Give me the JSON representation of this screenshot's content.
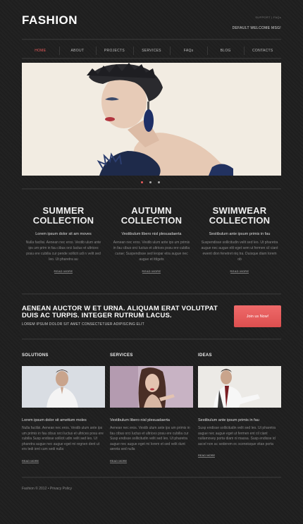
{
  "header": {
    "logo": "FASHION",
    "top_links": "SUPPORT | FAQs",
    "welcome": "DEFAULT WELCOME MSG!"
  },
  "nav": {
    "items": [
      "HOME",
      "ABOUT",
      "PROJECTS",
      "SERVICES",
      "FAQs",
      "BLOG",
      "CONTACTS"
    ],
    "active_index": 0
  },
  "slider": {
    "dot_count": 3,
    "active_dot": 0
  },
  "collections": [
    {
      "title_line1": "SUMMER",
      "title_line2": "COLLECTION",
      "subtitle": "Lorem ipsum dolor sit am moves",
      "text": "Nulla facilisi. Aenean nec eros. Vestib ulum ante ips um prim in fau cibus orci luctus et ultrices posu ere cubilia cur pende sollicit udi n velit sed leo. Ut pharetra au",
      "more": "READ MORE"
    },
    {
      "title_line1": "AUTUMN",
      "title_line2": "COLLECTION",
      "subtitle": "Vestibulum libero nisl plesuadaerta",
      "text": "Aenean nec eros. Vestib ulum ante ips um primis in fau cibus orci luctus et ultrices posu ere cubilia curae; Suspendisse sed leopar etra augue nec augue et ittigets",
      "more": "READ MORE"
    },
    {
      "title_line1": "SWIMWEAR",
      "title_line2": "COLLECTION",
      "subtitle": "Sestibulum ante ipsum primis in fau",
      "text": "Suspendisse sollicitudin velit sed leo. Ut pharetra augue nec augue elit eget sem ut fermen cil ciant ewent dion fenetret niq tra. Duisque diam lorem ob",
      "more": "READ MORE"
    }
  ],
  "promo": {
    "title": "AENEAN AUCTOR W ET URNA. ALIQUAM ERAT VOLUTPAT DUIS AC TURPIS. INTEGER RUTRUM LACUS.",
    "subtitle": "LOREM IPSUM DOLOR SIT AMET CONSECTETUER ADIPISCING ELIT",
    "button": "Join us Now!"
  },
  "features": [
    {
      "heading": "SOLUTIONS",
      "image": "man-in-white-shirt-photo",
      "subtitle": "Lorem ipsum dolor sit amettum moles",
      "text": "Nulla facilisi. Aenean nec eros. Vestib ulum ante ips um primis in fau cibus orci luctus et ultrices posu ere cubilia Susp endisse sollicit udin velit sed leo. Ut pharetra augue nec augue eget mi regnen dent ut ers tedi ient cum sedi nulla",
      "more": "READ MORE"
    },
    {
      "heading": "SERVICES",
      "image": "woman-with-long-hair-photo",
      "subtitle": "Vestibulum libero nisl plesuadaerta",
      "text": "Aenean nec eros. Vestib ulum ante ips um primis in fau cibus orci luctus et ultrices posu ere cubilia cur Susp endisse sollicitudin velit sed leo. Ut pharetra augue nec augue eget mi lorem et sed velit dunt aereta sed nulla",
      "more": "READ MORE"
    },
    {
      "heading": "IDEAS",
      "image": "man-in-white-jacket-photo",
      "subtitle": "Sestibulum ante ipsum primis in fau",
      "text": "Susp endisse sollicitudin velit sed leo. Ut pharetra augue nec augue eget ut fermen ent cil ciant nullamovey porta diam ni massa. Susp endisse id ascel non ac sederem ec sceneisque vitae porta",
      "more": "READ MORE"
    }
  ],
  "footer": {
    "text": "Fashion © 2012 • Privacy Policy"
  },
  "colors": {
    "accent": "#e85b5b",
    "background": "#1f1f1f"
  }
}
